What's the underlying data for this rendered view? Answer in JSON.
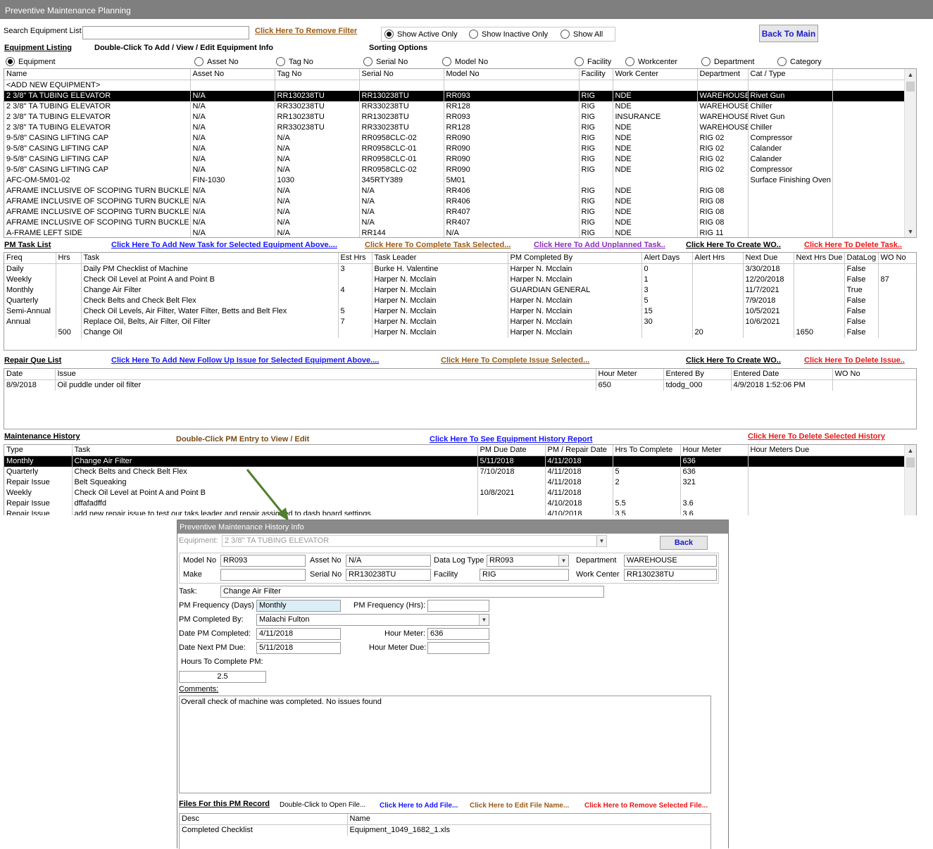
{
  "window": {
    "title": "Preventive Maintenance Planning"
  },
  "search": {
    "label": "Search Equipment List",
    "value": "",
    "remove_filter": "Click Here To Remove Filter"
  },
  "show_filter": {
    "options": [
      "Show Active Only",
      "Show Inactive Only",
      "Show All"
    ],
    "selected": 0
  },
  "back_to_main": "Back To Main",
  "equipment": {
    "heading": "Equipment Listing",
    "hint": "Double-Click To Add / View / Edit Equipment Info",
    "sorting_label": "Sorting Options",
    "sort_options": [
      "Equipment",
      "Asset No",
      "Tag No",
      "Serial No",
      "Model No",
      "Facility",
      "Workcenter",
      "Department",
      "Category"
    ],
    "columns": [
      "Name",
      "Asset No",
      "Tag No",
      "Serial No",
      "Model No",
      "Facility",
      "Work Center",
      "Department",
      "Cat / Type"
    ],
    "rows": [
      [
        "<ADD NEW EQUIPMENT>",
        "",
        "",
        "",
        "",
        "",
        "",
        "",
        ""
      ],
      [
        "2 3/8\" TA TUBING ELEVATOR",
        "N/A",
        "RR130238TU",
        "RR130238TU",
        "RR093",
        "RIG",
        "NDE",
        "WAREHOUSE",
        "Rivet Gun"
      ],
      [
        "2 3/8\" TA TUBING ELEVATOR",
        "N/A",
        "RR330238TU",
        "RR330238TU",
        "RR128",
        "RIG",
        "NDE",
        "WAREHOUSE",
        "Chiller"
      ],
      [
        "2 3/8\" TA TUBING ELEVATOR",
        "N/A",
        "RR130238TU",
        "RR130238TU",
        "RR093",
        "RIG",
        "INSURANCE",
        "WAREHOUSE",
        "Rivet Gun"
      ],
      [
        "2 3/8\" TA TUBING ELEVATOR",
        "N/A",
        "RR330238TU",
        "RR330238TU",
        "RR128",
        "RIG",
        "NDE",
        "WAREHOUSE",
        "Chiller"
      ],
      [
        "9-5/8\" CASING LIFTING CAP",
        "N/A",
        "N/A",
        "RR0958CLC-02",
        "RR090",
        "RIG",
        "NDE",
        "RIG 02",
        "Compressor"
      ],
      [
        "9-5/8\" CASING LIFTING CAP",
        "N/A",
        "N/A",
        "RR0958CLC-01",
        "RR090",
        "RIG",
        "NDE",
        "RIG 02",
        "Calander"
      ],
      [
        "9-5/8\" CASING LIFTING CAP",
        "N/A",
        "N/A",
        "RR0958CLC-01",
        "RR090",
        "RIG",
        "NDE",
        "RIG 02",
        "Calander"
      ],
      [
        "9-5/8\" CASING LIFTING CAP",
        "N/A",
        "N/A",
        "RR0958CLC-02",
        "RR090",
        "RIG",
        "NDE",
        "RIG 02",
        "Compressor"
      ],
      [
        "AFC-OM-5M01-02",
        "FIN-1030",
        "1030",
        "345RTY389",
        "5M01",
        "",
        "",
        "",
        "Surface Finishing Oven"
      ],
      [
        "AFRAME INCLUSIVE OF SCOPING TURN BUCKLE LEFT",
        "N/A",
        "N/A",
        "N/A",
        "RR406",
        "RIG",
        "NDE",
        "RIG 08",
        ""
      ],
      [
        "AFRAME INCLUSIVE OF SCOPING TURN BUCKLE LEFT",
        "N/A",
        "N/A",
        "N/A",
        "RR406",
        "RIG",
        "NDE",
        "RIG 08",
        ""
      ],
      [
        "AFRAME INCLUSIVE OF SCOPING TURN BUCKLE RIGHT",
        "N/A",
        "N/A",
        "N/A",
        "RR407",
        "RIG",
        "NDE",
        "RIG 08",
        ""
      ],
      [
        "AFRAME INCLUSIVE OF SCOPING TURN BUCKLE RIGHT",
        "N/A",
        "N/A",
        "N/A",
        "RR407",
        "RIG",
        "NDE",
        "RIG 08",
        ""
      ],
      [
        "A-FRAME LEFT SIDE",
        "N/A",
        "N/A",
        "RR144",
        "N/A",
        "RIG",
        "NDE",
        "RIG 11",
        ""
      ]
    ]
  },
  "pm_tasks": {
    "heading": "PM Task List",
    "links": [
      "Click Here To Add New Task for Selected Equipment Above....",
      "Click Here To Complete Task Selected...",
      "Click Here To Add Unplanned Task..",
      "Click Here To Create WO..",
      "Click Here To Delete Task.."
    ],
    "columns": [
      "Freq",
      "Hrs",
      "Task",
      "Est Hrs",
      "Task Leader",
      "PM Completed By",
      "Alert Days",
      "Alert Hrs",
      "Next Due",
      "Next Hrs Due",
      "DataLog",
      "WO No"
    ],
    "rows": [
      [
        "Daily",
        "",
        "Daily PM Checklist of Machine",
        "3",
        "Burke H. Valentine",
        "Harper N. Mcclain",
        "0",
        "",
        "3/30/2018",
        "",
        "False",
        ""
      ],
      [
        "Weekly",
        "",
        "Check Oil Level at Point A and Point B",
        "",
        "Harper N. Mcclain",
        "Harper N. Mcclain",
        "1",
        "",
        "12/20/2018",
        "",
        "False",
        "87"
      ],
      [
        "Monthly",
        "",
        "Change Air Filter",
        "4",
        "Harper N. Mcclain",
        "GUARDIAN GENERAL",
        "3",
        "",
        "11/7/2021",
        "",
        "True",
        ""
      ],
      [
        "Quarterly",
        "",
        "Check Belts and Check Belt Flex",
        "",
        "Harper N. Mcclain",
        "Harper N. Mcclain",
        "5",
        "",
        "7/9/2018",
        "",
        "False",
        ""
      ],
      [
        "Semi-Annual",
        "",
        "Check Oil Levels, Air Filter, Water Filter, Betts and Belt Flex",
        "5",
        "Harper N. Mcclain",
        "Harper N. Mcclain",
        "15",
        "",
        "10/5/2021",
        "",
        "False",
        ""
      ],
      [
        "Annual",
        "",
        "Replace Oil, Belts, Air Filter, Oil Filter",
        "7",
        "Harper N. Mcclain",
        "Harper N. Mcclain",
        "30",
        "",
        "10/6/2021",
        "",
        "False",
        ""
      ],
      [
        "",
        "500",
        "Change Oil",
        "",
        "Harper N. Mcclain",
        "Harper N. Mcclain",
        "",
        "20",
        "",
        "1650",
        "False",
        ""
      ]
    ]
  },
  "repair_queue": {
    "heading": "Repair Que List",
    "links": [
      "Click Here To Add New Follow Up Issue for Selected Equipment Above....",
      "Click Here To Complete Issue Selected...",
      "Click Here To Create WO..",
      "Click Here To Delete Issue.."
    ],
    "columns": [
      "Date",
      "Issue",
      "Hour Meter",
      "Entered By",
      "Entered Date",
      "WO No"
    ],
    "rows": [
      [
        "8/9/2018",
        "Oil puddle under oil filter",
        "650",
        "tdodg_000",
        "4/9/2018 1:52:06 PM",
        ""
      ]
    ]
  },
  "history": {
    "heading": "Maintenance History",
    "hint": "Double-Click PM Entry to View / Edit",
    "links": [
      "Click Here To See Equipment History Report",
      "Click Here To Delete Selected History"
    ],
    "columns": [
      "Type",
      "Task",
      "PM Due Date",
      "PM / Repair Date",
      "Hrs To Complete",
      "Hour Meter",
      "Hour Meters Due"
    ],
    "rows": [
      [
        "Monthly",
        "Change Air Filter",
        "5/11/2018",
        "4/11/2018",
        "",
        "636",
        ""
      ],
      [
        "Quarterly",
        "Check Belts and Check Belt Flex",
        "7/10/2018",
        "4/11/2018",
        "5",
        "636",
        ""
      ],
      [
        "Repair Issue",
        "Belt Squeaking",
        "",
        "4/11/2018",
        "2",
        "321",
        ""
      ],
      [
        "Weekly",
        "Check Oil Level at Point A and Point B",
        "10/8/2021",
        "4/11/2018",
        "",
        "",
        ""
      ],
      [
        "Repair Issue",
        "dffafadffd",
        "",
        "4/10/2018",
        "5.5",
        "3.6",
        ""
      ],
      [
        "Repair Issue",
        "add new repair issue to test our taks leader and repair assigned to dash board settings",
        "",
        "4/10/2018",
        "3.5",
        "3.6",
        ""
      ]
    ]
  },
  "dialog": {
    "title": "Preventive Maintenance History Info",
    "equipment_label": "Equipment:",
    "equipment_value": "2 3/8\" TA TUBING ELEVATOR",
    "back": "Back",
    "model_no_label": "Model No",
    "model_no": "RR093",
    "asset_no_label": "Asset No",
    "asset_no": "N/A",
    "data_log_type_label": "Data Log Type",
    "data_log_type": "RR093",
    "department_label": "Department",
    "department": "WAREHOUSE",
    "make_label": "Make",
    "make": "",
    "serial_no_label": "Serial No",
    "serial_no": "RR130238TU",
    "facility_label": "Facility",
    "facility": "RIG",
    "work_center_label": "Work Center",
    "work_center": "RR130238TU",
    "task_label": "Task:",
    "task": "Change Air Filter",
    "pm_freq_days_label": "PM Frequency (Days)",
    "pm_freq_days": "Monthly",
    "pm_freq_hrs_label": "PM Frequency (Hrs):",
    "pm_freq_hrs": "",
    "pm_completed_by_label": "PM Completed By:",
    "pm_completed_by": "Malachi Fulton",
    "date_completed_label": "Date PM Completed:",
    "date_completed": "4/11/2018",
    "hour_meter_label": "Hour Meter:",
    "hour_meter": "636",
    "date_next_label": "Date Next PM Due:",
    "date_next": "5/11/2018",
    "hour_meter_due_label": "Hour Meter Due:",
    "hour_meter_due": "",
    "hours_to_complete_label": "Hours To Complete PM:",
    "hours_to_complete": "2.5",
    "comments_label": "Comments:",
    "comments": "Overall check of machine was completed. No issues found",
    "files_heading": "Files For this PM Record",
    "files_hint": "Double-Click to Open File...",
    "add_file": "Click Here to Add File...",
    "edit_file": "Click Here to Edit File Name...",
    "remove_file": "Click Here to Remove Selected File...",
    "files_columns": [
      "Desc",
      "Name"
    ],
    "files_rows": [
      [
        "Completed Checklist",
        "Equipment_1049_1682_1.xls"
      ]
    ]
  },
  "colors": {
    "link_blue": "#1414ff",
    "link_brown": "#9a5b16",
    "link_purple": "#8b2fb8",
    "link_red": "#e81818",
    "arrow_green": "#4f7f2a",
    "selected_row": "#000000"
  }
}
